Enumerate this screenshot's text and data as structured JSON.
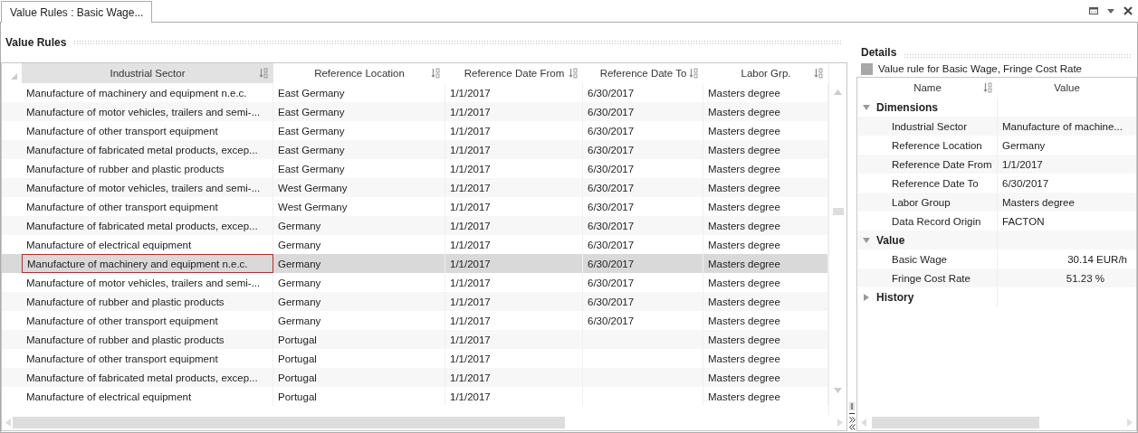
{
  "tabs": [
    {
      "label": "Value Rules : Basic Wage...",
      "selected": true
    }
  ],
  "value_rules": {
    "title": "Value Rules",
    "columns": [
      "Industrial Sector",
      "Reference Location",
      "Reference Date From",
      "Reference Date To",
      "Labor Grp."
    ],
    "rows": [
      {
        "sector": "Manufacture of machinery and equipment n.e.c.",
        "location": "East Germany",
        "from": "1/1/2017",
        "to": "6/30/2017",
        "labor": "Masters degree",
        "selected": false
      },
      {
        "sector": "Manufacture of motor vehicles, trailers and semi-...",
        "location": "East Germany",
        "from": "1/1/2017",
        "to": "6/30/2017",
        "labor": "Masters degree",
        "selected": false
      },
      {
        "sector": "Manufacture of other transport equipment",
        "location": "East Germany",
        "from": "1/1/2017",
        "to": "6/30/2017",
        "labor": "Masters degree",
        "selected": false
      },
      {
        "sector": "Manufacture of fabricated metal products, excep...",
        "location": "East Germany",
        "from": "1/1/2017",
        "to": "6/30/2017",
        "labor": "Masters degree",
        "selected": false
      },
      {
        "sector": "Manufacture of rubber and plastic products",
        "location": "East Germany",
        "from": "1/1/2017",
        "to": "6/30/2017",
        "labor": "Masters degree",
        "selected": false
      },
      {
        "sector": "Manufacture of motor vehicles, trailers and semi-...",
        "location": "West Germany",
        "from": "1/1/2017",
        "to": "6/30/2017",
        "labor": "Masters degree",
        "selected": false
      },
      {
        "sector": "Manufacture of other transport equipment",
        "location": "West Germany",
        "from": "1/1/2017",
        "to": "6/30/2017",
        "labor": "Masters degree",
        "selected": false
      },
      {
        "sector": "Manufacture of fabricated metal products, excep...",
        "location": "Germany",
        "from": "1/1/2017",
        "to": "6/30/2017",
        "labor": "Masters degree",
        "selected": false
      },
      {
        "sector": "Manufacture of electrical equipment",
        "location": "Germany",
        "from": "1/1/2017",
        "to": "6/30/2017",
        "labor": "Masters degree",
        "selected": false
      },
      {
        "sector": "Manufacture of machinery and equipment n.e.c.",
        "location": "Germany",
        "from": "1/1/2017",
        "to": "6/30/2017",
        "labor": "Masters degree",
        "selected": true
      },
      {
        "sector": "Manufacture of motor vehicles, trailers and semi-...",
        "location": "Germany",
        "from": "1/1/2017",
        "to": "6/30/2017",
        "labor": "Masters degree",
        "selected": false
      },
      {
        "sector": "Manufacture of rubber and plastic products",
        "location": "Germany",
        "from": "1/1/2017",
        "to": "6/30/2017",
        "labor": "Masters degree",
        "selected": false
      },
      {
        "sector": "Manufacture of other transport equipment",
        "location": "Germany",
        "from": "1/1/2017",
        "to": "6/30/2017",
        "labor": "Masters degree",
        "selected": false
      },
      {
        "sector": "Manufacture of rubber and plastic products",
        "location": "Portugal",
        "from": "1/1/2017",
        "labor": "Masters degree",
        "selected": false
      },
      {
        "sector": "Manufacture of other transport equipment",
        "location": "Portugal",
        "from": "1/1/2017",
        "labor": "Masters degree",
        "selected": false
      },
      {
        "sector": "Manufacture of fabricated metal products, excep...",
        "location": "Portugal",
        "from": "1/1/2017",
        "labor": "Masters degree",
        "selected": false
      },
      {
        "sector": "Manufacture of electrical equipment",
        "location": "Portugal",
        "from": "1/1/2017",
        "labor": "Masters degree",
        "selected": false
      }
    ]
  },
  "details": {
    "title": "Details",
    "subtitle": "Value rule for Basic Wage, Fringe Cost Rate",
    "columns": [
      "Name",
      "Value"
    ],
    "groups": [
      {
        "label": "Dimensions",
        "expanded": true,
        "children": [
          {
            "name": "Industrial Sector",
            "value": "Manufacture of machine...",
            "kind": "text"
          },
          {
            "name": "Reference Location",
            "value": "Germany",
            "kind": "text"
          },
          {
            "name": "Reference Date From",
            "value": "1/1/2017",
            "kind": "text"
          },
          {
            "name": "Reference Date To",
            "value": "6/30/2017",
            "kind": "text"
          },
          {
            "name": "Labor Group",
            "value": "Masters degree",
            "kind": "text"
          },
          {
            "name": "Data Record Origin",
            "value": "FACTON",
            "kind": "text"
          }
        ]
      },
      {
        "label": "Value",
        "expanded": true,
        "children": [
          {
            "name": "Basic Wage",
            "value": "30.14 EUR/h",
            "kind": "number"
          },
          {
            "name": "Fringe Cost Rate",
            "value": "51.23 %",
            "kind": "number"
          }
        ]
      },
      {
        "label": "History",
        "expanded": false
      }
    ]
  }
}
